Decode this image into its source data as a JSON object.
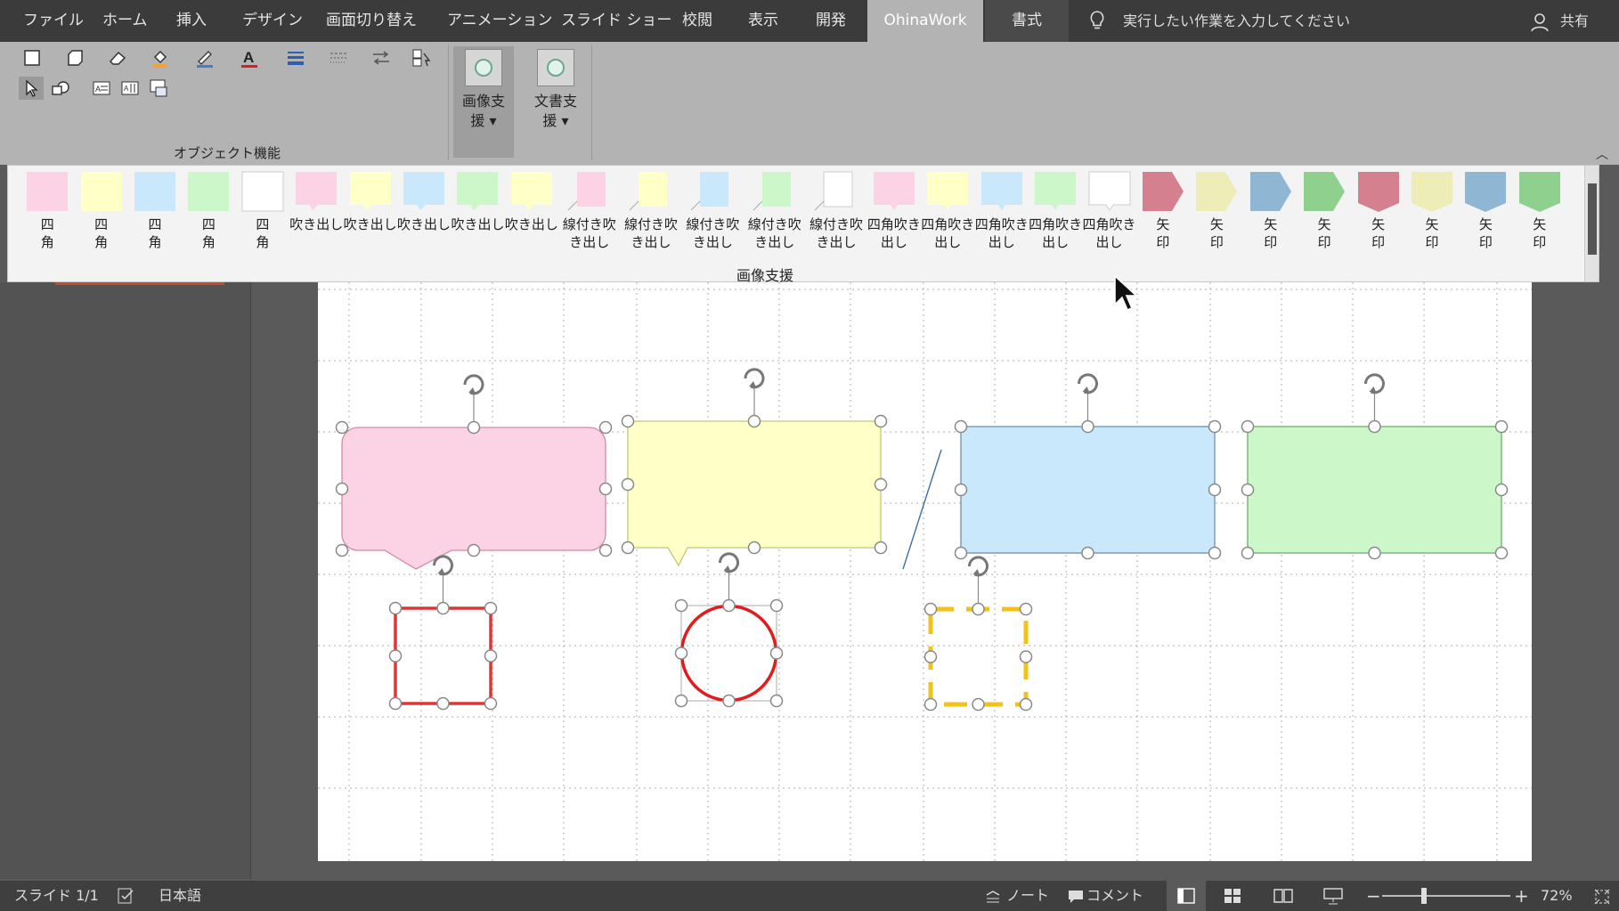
{
  "tabs": [
    "ファイル",
    "ホーム",
    "挿入",
    "デザイン",
    "画面切り替え",
    "アニメーション",
    "スライド ショー",
    "校閲",
    "表示",
    "開発",
    "OhinaWork",
    "書式"
  ],
  "active_tab": "OhinaWork",
  "tell_me": "実行したい作業を入力してください",
  "share": "共有",
  "ribbon": {
    "group_label": "オブジェクト機能",
    "image_support_label": "画像支援",
    "doc_support_label": "文書支援"
  },
  "gallery": {
    "title": "画像支援",
    "items": [
      {
        "label": "四角",
        "color": "#fcd3e4",
        "shape": "rect"
      },
      {
        "label": "四角",
        "color": "#ffffc8",
        "shape": "rect"
      },
      {
        "label": "四角",
        "color": "#c9e8fb",
        "shape": "rect"
      },
      {
        "label": "四角",
        "color": "#cbf7c9",
        "shape": "rect"
      },
      {
        "label": "四角",
        "color": "#ffffff",
        "shape": "rect"
      },
      {
        "label": "吹き出し",
        "color": "#fcd3e4",
        "shape": "callout"
      },
      {
        "label": "吹き出し",
        "color": "#ffffc8",
        "shape": "callout"
      },
      {
        "label": "吹き出し",
        "color": "#c9e8fb",
        "shape": "callout"
      },
      {
        "label": "吹き出し",
        "color": "#cbf7c9",
        "shape": "callout"
      },
      {
        "label": "吹き出し",
        "color": "#ffffc8",
        "shape": "callout"
      },
      {
        "label": "線付き吹き出し",
        "color": "#fcd3e4",
        "shape": "linecallout"
      },
      {
        "label": "線付き吹き出し",
        "color": "#ffffc8",
        "shape": "linecallout"
      },
      {
        "label": "線付き吹き出し",
        "color": "#c9e8fb",
        "shape": "linecallout"
      },
      {
        "label": "線付き吹き出し",
        "color": "#cbf7c9",
        "shape": "linecallout"
      },
      {
        "label": "線付き吹き出し",
        "color": "#ffffff",
        "shape": "linecallout"
      },
      {
        "label": "四角吹き出し",
        "color": "#fcd3e4",
        "shape": "rectcallout"
      },
      {
        "label": "四角吹き出し",
        "color": "#ffffc8",
        "shape": "rectcallout"
      },
      {
        "label": "四角吹き出し",
        "color": "#c9e8fb",
        "shape": "rectcallout"
      },
      {
        "label": "四角吹き出し",
        "color": "#cbf7c9",
        "shape": "rectcallout"
      },
      {
        "label": "四角吹き出し",
        "color": "#ffffff",
        "shape": "rectcallout"
      },
      {
        "label": "矢印",
        "color": "#d4808f",
        "shape": "pentagon"
      },
      {
        "label": "矢印",
        "color": "#eeecb7",
        "shape": "pentagon"
      },
      {
        "label": "矢印",
        "color": "#8fb6d3",
        "shape": "pentagon"
      },
      {
        "label": "矢印",
        "color": "#8fd08f",
        "shape": "pentagon"
      },
      {
        "label": "矢印",
        "color": "#d4808f",
        "shape": "chevdown"
      },
      {
        "label": "矢印",
        "color": "#eeecb7",
        "shape": "chevdown"
      },
      {
        "label": "矢印",
        "color": "#8fb6d3",
        "shape": "chevdown"
      },
      {
        "label": "矢印",
        "color": "#8fd08f",
        "shape": "chevdown"
      }
    ]
  },
  "slide": {
    "shapes": [
      {
        "kind": "rounded-callout",
        "fill": "#fcd3e4",
        "stroke": "#d48aa5"
      },
      {
        "kind": "rect-callout",
        "fill": "#ffffc8",
        "stroke": "#c8c27a"
      },
      {
        "kind": "rect",
        "fill": "#c9e8fb",
        "stroke": "#6f8fa8"
      },
      {
        "kind": "rect",
        "fill": "#cbf7c9",
        "stroke": "#7bb87b"
      },
      {
        "kind": "outline-square",
        "stroke": "#e03535"
      },
      {
        "kind": "outline-circle",
        "stroke": "#e01c1c"
      },
      {
        "kind": "dashed-square",
        "stroke": "#f2c21b"
      }
    ]
  },
  "status": {
    "slide": "スライド 1/1",
    "language": "日本語",
    "notes": "ノート",
    "comments": "コメント",
    "zoom": "72%"
  }
}
